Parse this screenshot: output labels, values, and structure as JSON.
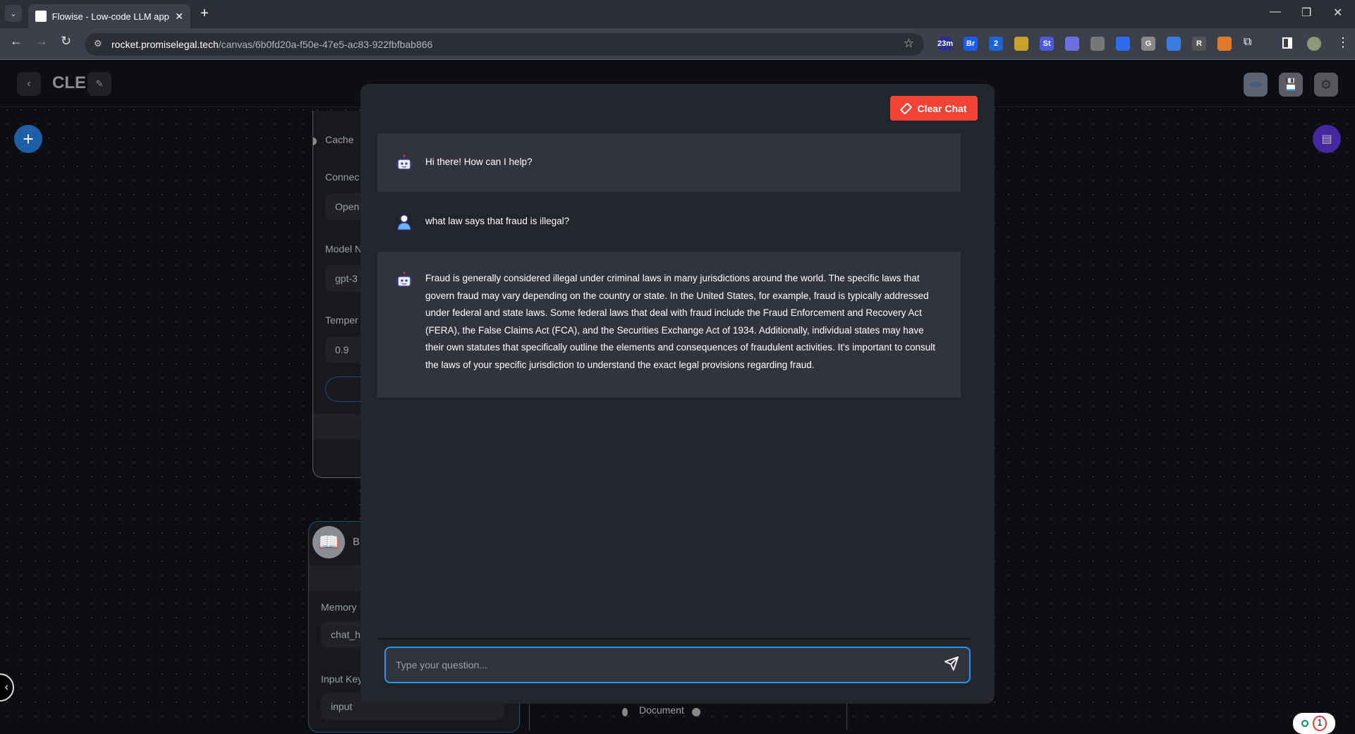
{
  "browser": {
    "tab_title": "Flowise - Low-code LLM apps builder",
    "url_host": "rocket.promiselegal.tech",
    "url_path": "/canvas/6b0fd20a-f50e-47e5-ac83-922fbfbab866",
    "extensions": [
      {
        "label": "23m",
        "color": "#2d2f8a"
      },
      {
        "label": "Br",
        "color": "#1a5cff"
      },
      {
        "label": "2",
        "color": "#1e63d6"
      },
      {
        "label": "",
        "color": "#c9a227"
      },
      {
        "label": "St",
        "color": "#4b5ae0"
      },
      {
        "label": "",
        "color": "#6b6fe0"
      },
      {
        "label": "",
        "color": "#777"
      },
      {
        "label": "",
        "color": "#2b6cf0"
      },
      {
        "label": "G",
        "color": "#888"
      },
      {
        "label": "",
        "color": "#3a7ce0"
      },
      {
        "label": "R",
        "color": "#555"
      },
      {
        "label": "",
        "color": "#e07a2b"
      }
    ]
  },
  "header": {
    "title": "CLE"
  },
  "canvas": {
    "node1": {
      "cache_label": "Cache",
      "connect_label": "Connec",
      "connect_value": "Open",
      "model_label": "Model N",
      "model_value": "gpt-3",
      "temp_label": "Temper",
      "temp_value": "0.9"
    },
    "node2": {
      "title": "B",
      "memory_label": "Memory",
      "memory_value": "chat_h",
      "input_key_label": "Input Key",
      "input_key_value": "input"
    },
    "node3": {
      "document_label": "Document"
    }
  },
  "chat": {
    "clear_label": "Clear Chat",
    "messages": [
      {
        "role": "bot",
        "text": "Hi there! How can I help?"
      },
      {
        "role": "user",
        "text": "what law says that fraud is illegal?"
      },
      {
        "role": "bot",
        "text": "Fraud is generally considered illegal under criminal laws in many jurisdictions around the world. The specific laws that govern fraud may vary depending on the country or state. In the United States, for example, fraud is typically addressed under federal and state laws. Some federal laws that deal with fraud include the Fraud Enforcement and Recovery Act (FERA), the False Claims Act (FCA), and the Securities Exchange Act of 1934. Additionally, individual states may have their own statutes that specifically outline the elements and consequences of fraudulent activities. It's important to consult the laws of your specific jurisdiction to understand the exact legal provisions regarding fraud."
      }
    ],
    "input_placeholder": "Type your question...",
    "input_value": ""
  },
  "notification_count": "1",
  "colors": {
    "accent": "#2196f3",
    "danger": "#f44336",
    "chat_fab": "#4527a0",
    "add_fab": "#1e5fa8"
  }
}
